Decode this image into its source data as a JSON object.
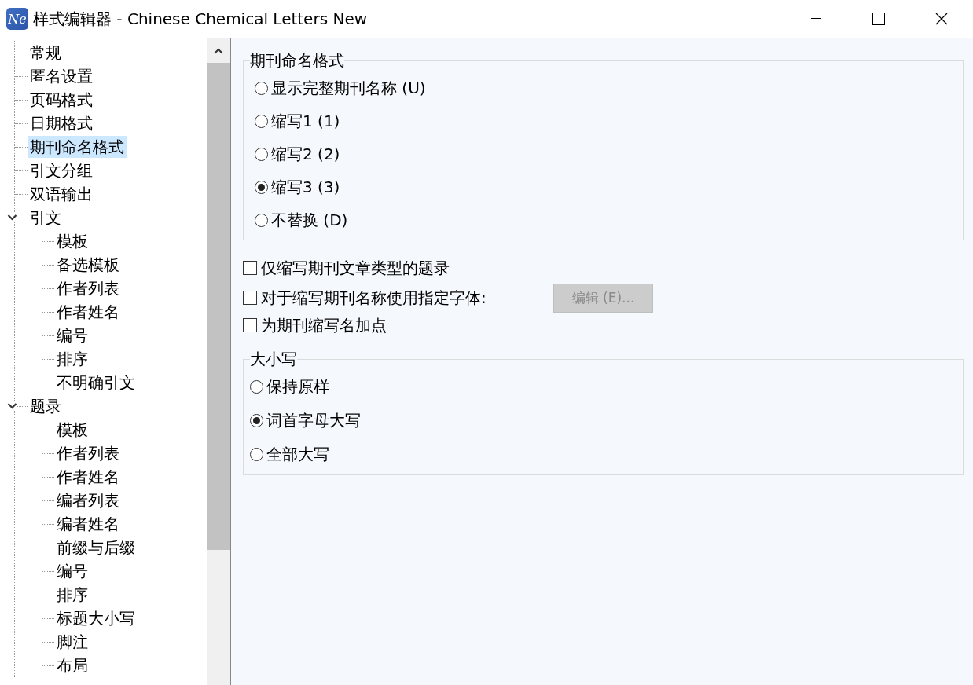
{
  "window": {
    "app_icon": "Ne",
    "title": "样式编辑器 - Chinese Chemical Letters New"
  },
  "tree": {
    "items": [
      {
        "label": "常规",
        "selected": false
      },
      {
        "label": "匿名设置",
        "selected": false
      },
      {
        "label": "页码格式",
        "selected": false
      },
      {
        "label": "日期格式",
        "selected": false
      },
      {
        "label": "期刊命名格式",
        "selected": true
      },
      {
        "label": "引文分组",
        "selected": false
      },
      {
        "label": "双语输出",
        "selected": false
      },
      {
        "label": "引文",
        "selected": false,
        "expanded": true,
        "children": [
          {
            "label": "模板",
            "selected": false
          },
          {
            "label": "备选模板",
            "selected": false
          },
          {
            "label": "作者列表",
            "selected": false
          },
          {
            "label": "作者姓名",
            "selected": false
          },
          {
            "label": "编号",
            "selected": false
          },
          {
            "label": "排序",
            "selected": false
          },
          {
            "label": "不明确引文",
            "selected": false
          }
        ]
      },
      {
        "label": "题录",
        "selected": false,
        "expanded": true,
        "children": [
          {
            "label": "模板",
            "selected": false
          },
          {
            "label": "作者列表",
            "selected": false
          },
          {
            "label": "作者姓名",
            "selected": false
          },
          {
            "label": "编者列表",
            "selected": false
          },
          {
            "label": "编者姓名",
            "selected": false
          },
          {
            "label": "前缀与后缀",
            "selected": false
          },
          {
            "label": "编号",
            "selected": false
          },
          {
            "label": "排序",
            "selected": false
          },
          {
            "label": "标题大小写",
            "selected": false
          },
          {
            "label": "脚注",
            "selected": false
          },
          {
            "label": "布局",
            "selected": false
          }
        ]
      }
    ]
  },
  "journal_names": {
    "legend": "期刊命名格式",
    "options": [
      {
        "label": "显示完整期刊名称 (U)",
        "selected": false
      },
      {
        "label": "缩写1 (1)",
        "selected": false
      },
      {
        "label": "缩写2 (2)",
        "selected": false
      },
      {
        "label": "缩写3 (3)",
        "selected": true
      },
      {
        "label": "不替换 (D)",
        "selected": false
      }
    ]
  },
  "checkboxes": [
    {
      "label": "仅缩写期刊文章类型的题录",
      "checked": false
    },
    {
      "label": "对于缩写期刊名称使用指定字体:",
      "checked": false,
      "button": {
        "label": "编辑 (E)...",
        "disabled": true
      }
    },
    {
      "label": "为期刊缩写名加点",
      "checked": false
    }
  ],
  "capitalization": {
    "legend": "大小写",
    "options": [
      {
        "label": "保持原样",
        "selected": false
      },
      {
        "label": "词首字母大写",
        "selected": true
      },
      {
        "label": "全部大写",
        "selected": false
      }
    ]
  }
}
